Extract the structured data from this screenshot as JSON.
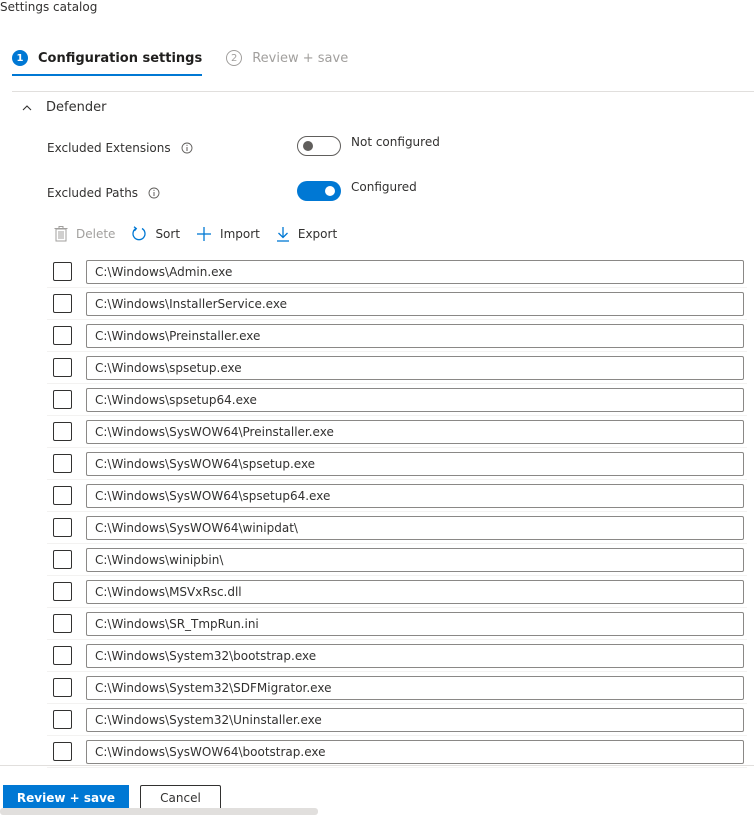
{
  "page": {
    "title": "Settings catalog"
  },
  "stepper": {
    "steps": [
      {
        "number": "1",
        "label": "Configuration settings",
        "state": "active"
      },
      {
        "number": "2",
        "label": "Review + save",
        "state": "inactive"
      }
    ]
  },
  "section": {
    "title": "Defender",
    "expanded": true,
    "settings": [
      {
        "label": "Excluded Extensions",
        "info_icon": "info-icon",
        "toggle_state": "off",
        "toggle_label": "Not configured"
      },
      {
        "label": "Excluded Paths",
        "info_icon": "info-icon",
        "toggle_state": "on",
        "toggle_label": "Configured"
      }
    ]
  },
  "toolbar": {
    "delete_label": "Delete",
    "sort_label": "Sort",
    "import_label": "Import",
    "export_label": "Export"
  },
  "paths": [
    "C:\\Windows\\Admin.exe",
    "C:\\Windows\\InstallerService.exe",
    "C:\\Windows\\Preinstaller.exe",
    "C:\\Windows\\spsetup.exe",
    "C:\\Windows\\spsetup64.exe",
    "C:\\Windows\\SysWOW64\\Preinstaller.exe",
    "C:\\Windows\\SysWOW64\\spsetup.exe",
    "C:\\Windows\\SysWOW64\\spsetup64.exe",
    "C:\\Windows\\SysWOW64\\winipdat\\",
    "C:\\Windows\\winipbin\\",
    "C:\\Windows\\MSVxRsc.dll",
    "C:\\Windows\\SR_TmpRun.ini",
    "C:\\Windows\\System32\\bootstrap.exe",
    "C:\\Windows\\System32\\SDFMigrator.exe",
    "C:\\Windows\\System32\\Uninstaller.exe",
    "C:\\Windows\\SysWOW64\\bootstrap.exe"
  ],
  "footer": {
    "primary_label": "Review + save",
    "secondary_label": "Cancel"
  },
  "colors": {
    "accent": "#0078d4",
    "text": "#323130",
    "disabled": "#a19f9d"
  }
}
